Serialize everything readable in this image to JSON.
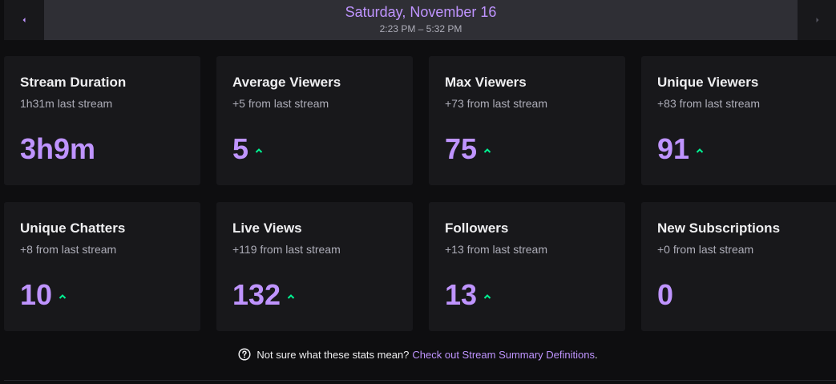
{
  "header": {
    "date_title": "Saturday, November 16",
    "time_range": "2:23 PM – 5:32 PM",
    "prev_icon": "chevron-left-icon",
    "next_icon": "chevron-right-icon"
  },
  "stats": [
    {
      "title": "Stream Duration",
      "sub": "1h31m last stream",
      "value": "3h9m",
      "trend": "none"
    },
    {
      "title": "Average Viewers",
      "sub": "+5 from last stream",
      "value": "5",
      "trend": "up"
    },
    {
      "title": "Max Viewers",
      "sub": "+73 from last stream",
      "value": "75",
      "trend": "up"
    },
    {
      "title": "Unique Viewers",
      "sub": "+83 from last stream",
      "value": "91",
      "trend": "up"
    },
    {
      "title": "Unique Chatters",
      "sub": "+8 from last stream",
      "value": "10",
      "trend": "up"
    },
    {
      "title": "Live Views",
      "sub": "+119 from last stream",
      "value": "132",
      "trend": "up"
    },
    {
      "title": "Followers",
      "sub": "+13 from last stream",
      "value": "13",
      "trend": "up"
    },
    {
      "title": "New Subscriptions",
      "sub": "+0 from last stream",
      "value": "0",
      "trend": "none"
    }
  ],
  "help": {
    "text": "Not sure what these stats mean?",
    "link": "Check out Stream Summary Definitions",
    "period": "."
  },
  "colors": {
    "accent": "#bf94ff",
    "trend_up": "#00f593",
    "card_bg": "#18181b",
    "page_bg": "#0e0e10"
  }
}
